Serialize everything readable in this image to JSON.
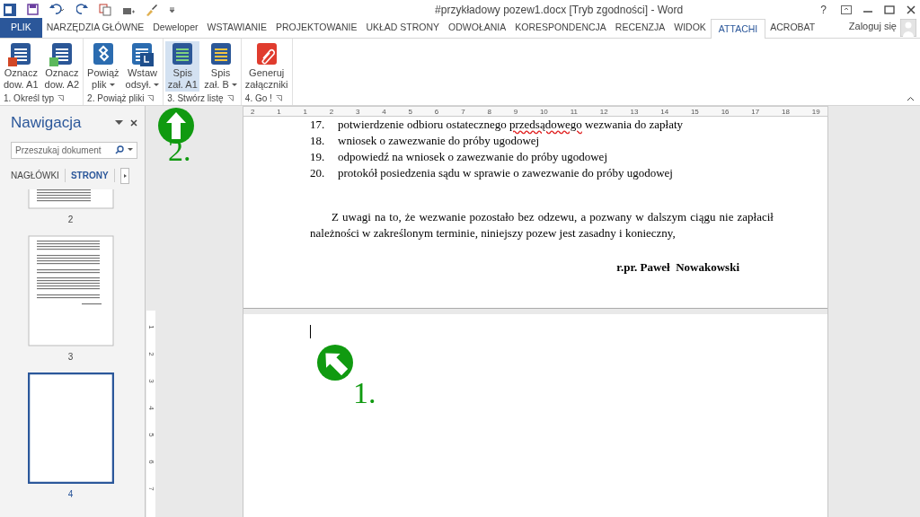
{
  "window": {
    "title": "#przykładowy pozew1.docx [Tryb zgodności] - Word",
    "help": "?"
  },
  "ribbon_tabs": [
    {
      "label": "PLIK",
      "kind": "file",
      "selected": false
    },
    {
      "label": "NARZĘDZIA GŁÓWNE",
      "kind": "tab",
      "selected": false
    },
    {
      "label": "Deweloper",
      "kind": "tab",
      "selected": false
    },
    {
      "label": "WSTAWIANIE",
      "kind": "tab",
      "selected": false
    },
    {
      "label": "PROJEKTOWANIE",
      "kind": "tab",
      "selected": false
    },
    {
      "label": "UKŁAD STRONY",
      "kind": "tab",
      "selected": false
    },
    {
      "label": "ODWOŁANIA",
      "kind": "tab",
      "selected": false
    },
    {
      "label": "KORESPONDENCJA",
      "kind": "tab",
      "selected": false
    },
    {
      "label": "RECENZJA",
      "kind": "tab",
      "selected": false
    },
    {
      "label": "WIDOK",
      "kind": "tab",
      "selected": false
    },
    {
      "label": "ATTACHI",
      "kind": "tab",
      "selected": true
    },
    {
      "label": "ACROBAT",
      "kind": "tab",
      "selected": false
    }
  ],
  "sign_in": "Zaloguj się",
  "ribbon_groups": [
    {
      "label": "1. Określ typ",
      "buttons": [
        {
          "lines": [
            "Oznacz",
            "dow. A1"
          ],
          "menu": false,
          "selected": false
        },
        {
          "lines": [
            "Oznacz",
            "dow. A2"
          ],
          "menu": false,
          "selected": false
        }
      ]
    },
    {
      "label": "2. Powiąż pliki",
      "buttons": [
        {
          "lines": [
            "Powiąż",
            "plik"
          ],
          "menu": true,
          "selected": false
        },
        {
          "lines": [
            "Wstaw",
            "odsył."
          ],
          "menu": true,
          "selected": false
        }
      ]
    },
    {
      "label": "3. Stwórz listę",
      "buttons": [
        {
          "lines": [
            "Spis",
            "zał. A1"
          ],
          "menu": false,
          "selected": true
        },
        {
          "lines": [
            "Spis",
            "zał. B"
          ],
          "menu": true,
          "selected": false
        }
      ]
    },
    {
      "label": "4. Go !",
      "buttons": [
        {
          "lines": [
            "Generuj",
            "załączniki"
          ],
          "menu": false,
          "selected": false
        }
      ]
    }
  ],
  "navigation": {
    "title": "Nawigacja",
    "search": {
      "placeholder": "Przeszukaj dokument"
    },
    "tabs": [
      {
        "label": "NAGŁÓWKI",
        "selected": false
      },
      {
        "label": "STRONY",
        "selected": true
      }
    ],
    "pages": [
      {
        "number": "2",
        "selected": false,
        "kind": "partial"
      },
      {
        "number": "3",
        "selected": false,
        "kind": "text"
      },
      {
        "number": "4",
        "selected": true,
        "kind": "blank"
      }
    ]
  },
  "ruler": {
    "labels": [
      "2",
      "1",
      "1",
      "2",
      "3",
      "4",
      "5",
      "6",
      "7",
      "8",
      "9",
      "10",
      "11",
      "12",
      "13",
      "14",
      "15",
      "16",
      "17",
      "18",
      "19"
    ]
  },
  "vertical_ruler": {
    "labels": [
      "1",
      "2",
      "3",
      "4",
      "5",
      "6",
      "7"
    ]
  },
  "document": {
    "list": [
      {
        "number": "17.",
        "parts": [
          {
            "text": "potwierdzenie odbioru ostatecznego ",
            "error": false
          },
          {
            "text": "przedsądowego",
            "error": true
          },
          {
            "text": " wezwania do zapłaty",
            "error": false
          }
        ]
      },
      {
        "number": "18.",
        "parts": [
          {
            "text": "wniosek o zawezwanie do próby ugodowej",
            "error": false
          }
        ]
      },
      {
        "number": "19.",
        "parts": [
          {
            "text": "odpowiedź na wniosek o zawezwanie do próby ugodowej",
            "error": false
          }
        ]
      },
      {
        "number": "20.",
        "parts": [
          {
            "text": "protokół posiedzenia sądu w sprawie o zawezwanie do próby ugodowej",
            "error": false
          }
        ]
      }
    ],
    "paragraph": "Z uwagi na to, że wezwanie pozostało bez odzewu, a pozwany w dalszym ciągu nie zapłacił należności w zakreślonym terminie, niniejszy pozew jest zasadny i konieczny,",
    "signature": "r.pr. Paweł  Nowakowski"
  },
  "annotations": [
    {
      "label": "2.",
      "kind": "up"
    },
    {
      "label": "1.",
      "kind": "up-left"
    }
  ]
}
